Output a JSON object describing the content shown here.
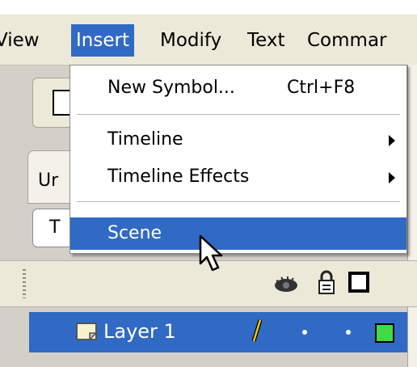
{
  "menubar": {
    "items": [
      {
        "label": "View"
      },
      {
        "label": "Insert",
        "active": true
      },
      {
        "label": "Modify"
      },
      {
        "label": "Text"
      },
      {
        "label": "Commar"
      }
    ]
  },
  "insert_menu": {
    "items": [
      {
        "label": "New Symbol...",
        "shortcut": "Ctrl+F8"
      },
      {
        "label": "Timeline",
        "submenu": true
      },
      {
        "label": "Timeline Effects",
        "submenu": true
      },
      {
        "label": "Scene",
        "highlighted": true
      }
    ]
  },
  "workspace": {
    "tab_label": "Ur",
    "scene_field_text": "T"
  },
  "timeline": {
    "header_icons": [
      "eye-icon",
      "lock-icon",
      "outline-icon"
    ],
    "layer": {
      "name": "Layer 1",
      "icon": "layer-icon",
      "outline_color": "#44d844"
    }
  },
  "colors": {
    "highlight": "#316ac5",
    "menubar": "#ece9d8"
  }
}
